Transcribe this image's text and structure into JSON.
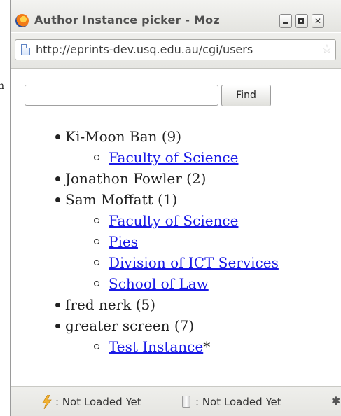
{
  "window": {
    "title": "Author Instance picker - Moz",
    "buttons": {
      "minimize": "minimize",
      "maximize": "maximize",
      "close": "close"
    }
  },
  "address_bar": {
    "url": "http://eprints-dev.usq.edu.au/cgi/users"
  },
  "search": {
    "value": "",
    "placeholder": "",
    "button_label": "Find"
  },
  "authors": [
    {
      "name": "Ki-Moon Ban (9)",
      "instances": [
        {
          "label": "Faculty of Science",
          "suffix": ""
        }
      ]
    },
    {
      "name": "Jonathon Fowler (2)",
      "instances": []
    },
    {
      "name": "Sam Moffatt (1)",
      "instances": [
        {
          "label": "Faculty of Science",
          "suffix": ""
        },
        {
          "label": "Pies",
          "suffix": ""
        },
        {
          "label": "Division of ICT Services",
          "suffix": ""
        },
        {
          "label": "School of Law",
          "suffix": ""
        }
      ]
    },
    {
      "name": "fred nerk (5)",
      "instances": []
    },
    {
      "name": "greater screen (7)",
      "instances": [
        {
          "label": "Test Instance",
          "suffix": "*"
        }
      ]
    }
  ],
  "status_bar": {
    "item1": ": Not Loaded Yet",
    "item2": ": Not Loaded Yet"
  },
  "icons": {
    "app": "firefox-icon",
    "page": "page-icon",
    "bookmark": "star-icon",
    "status1": "lightning-icon",
    "status2": "jar-icon",
    "status3": "bug-icon"
  }
}
